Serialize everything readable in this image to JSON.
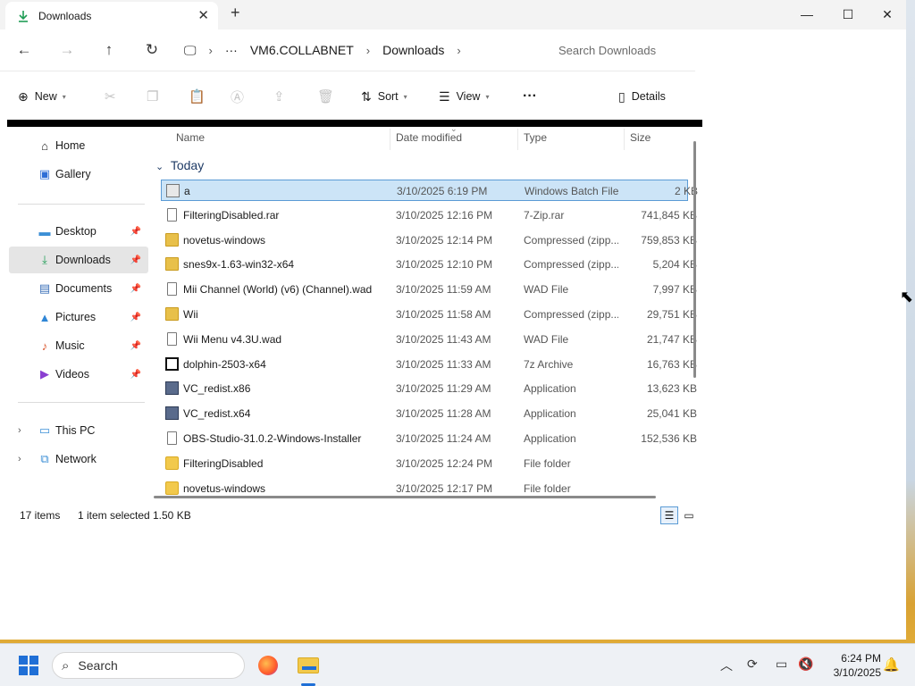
{
  "window": {
    "tab_title": "Downloads",
    "tab_close": "✕",
    "new_tab": "+",
    "minimize": "—",
    "maximize": "☐",
    "close": "✕"
  },
  "address": {
    "more": "···",
    "crumbs": [
      "VM6.COLLABNET",
      "Downloads"
    ],
    "search_placeholder": "Search Downloads"
  },
  "toolbar": {
    "new_label": "New",
    "sort_label": "Sort",
    "view_label": "View",
    "more_label": "···",
    "details_label": "Details"
  },
  "sidebar": {
    "items": [
      {
        "label": "Home"
      },
      {
        "label": "Gallery"
      },
      {
        "label": "Desktop"
      },
      {
        "label": "Downloads"
      },
      {
        "label": "Documents"
      },
      {
        "label": "Pictures"
      },
      {
        "label": "Music"
      },
      {
        "label": "Videos"
      },
      {
        "label": "This PC"
      },
      {
        "label": "Network"
      }
    ]
  },
  "list": {
    "columns": [
      "Name",
      "Date modified",
      "Type",
      "Size"
    ],
    "group": "Today",
    "rows": [
      {
        "name": "a",
        "date": "3/10/2025 6:19 PM",
        "type": "Windows Batch File",
        "size": "2 KB",
        "icon": "batch-file"
      },
      {
        "name": "FilteringDisabled.rar",
        "date": "3/10/2025 12:16 PM",
        "type": "7-Zip.rar",
        "size": "741,845 KB",
        "icon": "document"
      },
      {
        "name": "novetus-windows",
        "date": "3/10/2025 12:14 PM",
        "type": "Compressed (zipp...",
        "size": "759,853 KB",
        "icon": "zip-folder"
      },
      {
        "name": "snes9x-1.63-win32-x64",
        "date": "3/10/2025 12:10 PM",
        "type": "Compressed (zipp...",
        "size": "5,204 KB",
        "icon": "zip-folder"
      },
      {
        "name": "Mii Channel (World) (v6) (Channel).wad",
        "date": "3/10/2025 11:59 AM",
        "type": "WAD File",
        "size": "7,997 KB",
        "icon": "document"
      },
      {
        "name": "Wii",
        "date": "3/10/2025 11:58 AM",
        "type": "Compressed (zipp...",
        "size": "29,751 KB",
        "icon": "zip-folder"
      },
      {
        "name": "Wii Menu v4.3U.wad",
        "date": "3/10/2025 11:43 AM",
        "type": "WAD File",
        "size": "21,747 KB",
        "icon": "document"
      },
      {
        "name": "dolphin-2503-x64",
        "date": "3/10/2025 11:33 AM",
        "type": "7z Archive",
        "size": "16,763 KB",
        "icon": "7z-archive"
      },
      {
        "name": "VC_redist.x86",
        "date": "3/10/2025 11:29 AM",
        "type": "Application",
        "size": "13,623 KB",
        "icon": "installer"
      },
      {
        "name": "VC_redist.x64",
        "date": "3/10/2025 11:28 AM",
        "type": "Application",
        "size": "25,041 KB",
        "icon": "installer"
      },
      {
        "name": "OBS-Studio-31.0.2-Windows-Installer",
        "date": "3/10/2025 11:24 AM",
        "type": "Application",
        "size": "152,536 KB",
        "icon": "document"
      },
      {
        "name": "FilteringDisabled",
        "date": "3/10/2025 12:24 PM",
        "type": "File folder",
        "size": "",
        "icon": "folder"
      },
      {
        "name": "novetus-windows",
        "date": "3/10/2025 12:17 PM",
        "type": "File folder",
        "size": "",
        "icon": "folder"
      }
    ]
  },
  "status": {
    "count": "17 items",
    "selection": "1 item selected",
    "size": "1.50 KB"
  },
  "taskbar": {
    "search_label": "Search",
    "time": "6:24 PM",
    "date": "3/10/2025"
  },
  "colors": {
    "accent": "#1f6fd6",
    "selection": "#cce4f7",
    "selection_border": "#5b9bd5"
  }
}
